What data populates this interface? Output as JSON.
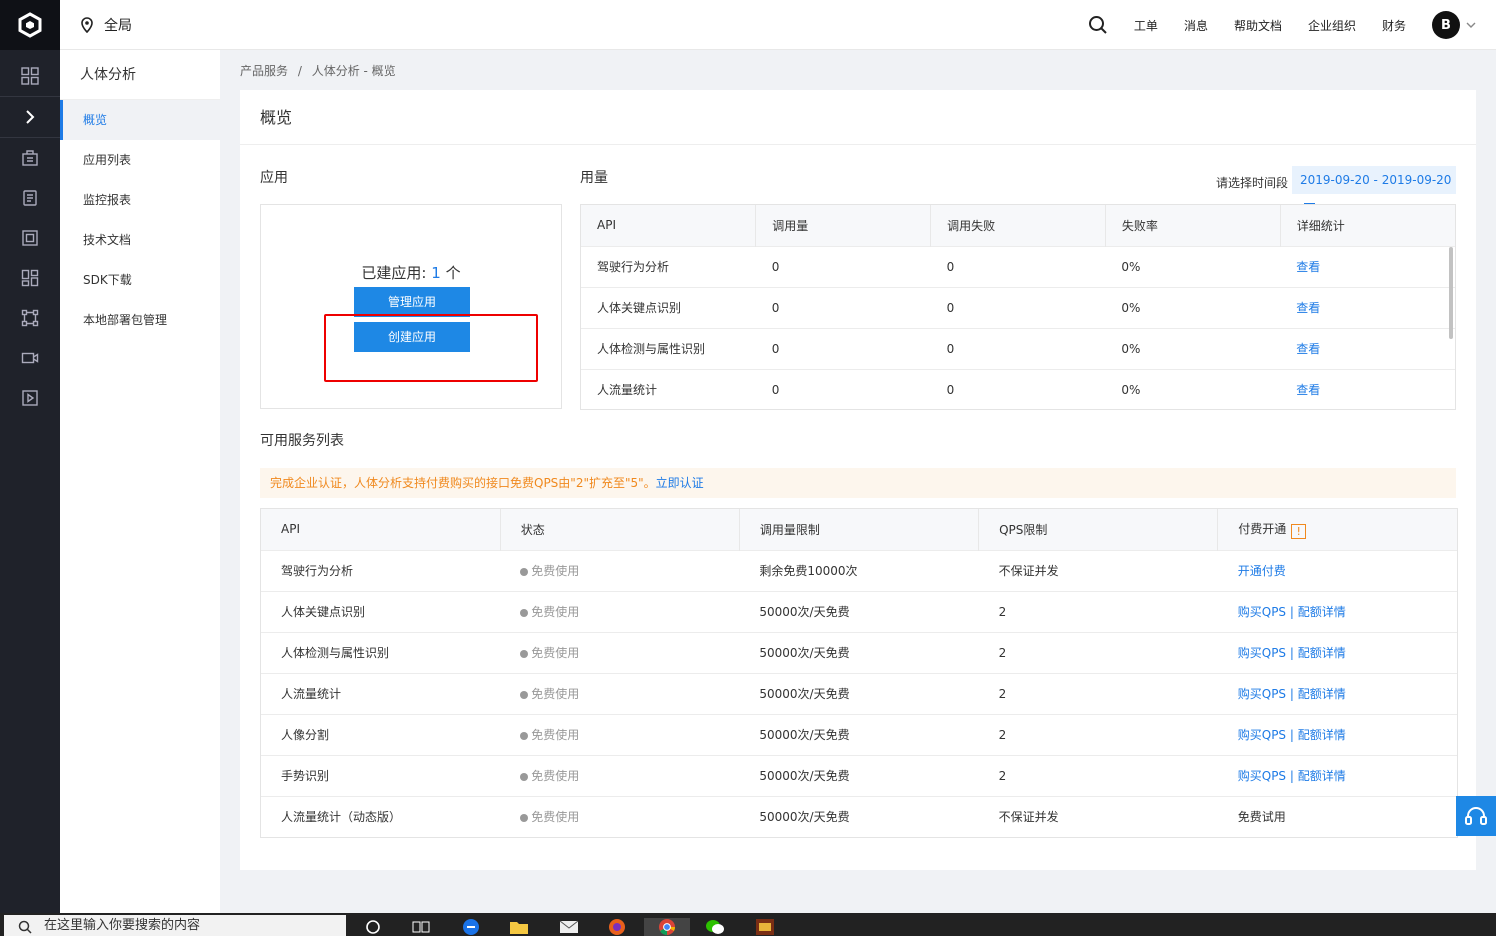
{
  "rail": {
    "icons": [
      "logo-icon",
      "grid-icon",
      "expand-chevron-icon",
      "building-icon",
      "book-icon",
      "frame-icon",
      "dashboard-icon",
      "network-icon",
      "camera-icon",
      "play-icon"
    ]
  },
  "topbar": {
    "region": "全局",
    "nav": [
      "工单",
      "消息",
      "帮助文档",
      "企业组织",
      "财务"
    ],
    "avatar": "B"
  },
  "sidenav": {
    "title": "人体分析",
    "items": [
      "概览",
      "应用列表",
      "监控报表",
      "技术文档",
      "SDK下载",
      "本地部署包管理"
    ],
    "active": "概览"
  },
  "breadcrumb": {
    "parent": "产品服务",
    "sep": "/",
    "current": "人体分析 - 概览"
  },
  "panel": {
    "title": "概览"
  },
  "apps": {
    "label": "应用",
    "count_prefix": "已建应用: ",
    "count": "1",
    "count_suffix": " 个",
    "manage_btn": "管理应用",
    "create_btn": "创建应用"
  },
  "usage": {
    "label": "用量",
    "date_label": "请选择时间段",
    "date_range": "2019-09-20 - 2019-09-20",
    "headers": [
      "API",
      "调用量",
      "调用失败",
      "失败率",
      "详细统计"
    ],
    "rows": [
      {
        "api": "驾驶行为分析",
        "calls": "0",
        "fails": "0",
        "rate": "0%",
        "detail": "查看"
      },
      {
        "api": "人体关键点识别",
        "calls": "0",
        "fails": "0",
        "rate": "0%",
        "detail": "查看"
      },
      {
        "api": "人体检测与属性识别",
        "calls": "0",
        "fails": "0",
        "rate": "0%",
        "detail": "查看"
      },
      {
        "api": "人流量统计",
        "calls": "0",
        "fails": "0",
        "rate": "0%",
        "detail": "查看"
      }
    ]
  },
  "services": {
    "label": "可用服务列表",
    "notice": "完成企业认证，人体分析支持付费购买的接口免费QPS由\"2\"扩充至\"5\"。",
    "notice_link": "立即认证",
    "headers": [
      "API",
      "状态",
      "调用量限制",
      "QPS限制",
      "付费开通"
    ],
    "info_badge": "!",
    "rows": [
      {
        "api": "驾驶行为分析",
        "status": "免费使用",
        "limit": "剩余免费10000次",
        "qps": "不保证并发",
        "pay": "开通付费",
        "pay2": "",
        "paytype": "link"
      },
      {
        "api": "人体关键点识别",
        "status": "免费使用",
        "limit": "50000次/天免费",
        "qps": "2",
        "pay": "购买QPS",
        "pay2": "配额详情",
        "paytype": "double"
      },
      {
        "api": "人体检测与属性识别",
        "status": "免费使用",
        "limit": "50000次/天免费",
        "qps": "2",
        "pay": "购买QPS",
        "pay2": "配额详情",
        "paytype": "double"
      },
      {
        "api": "人流量统计",
        "status": "免费使用",
        "limit": "50000次/天免费",
        "qps": "2",
        "pay": "购买QPS",
        "pay2": "配额详情",
        "paytype": "double"
      },
      {
        "api": "人像分割",
        "status": "免费使用",
        "limit": "50000次/天免费",
        "qps": "2",
        "pay": "购买QPS",
        "pay2": "配额详情",
        "paytype": "double"
      },
      {
        "api": "手势识别",
        "status": "免费使用",
        "limit": "50000次/天免费",
        "qps": "2",
        "pay": "购买QPS",
        "pay2": "配额详情",
        "paytype": "double"
      },
      {
        "api": "人流量统计（动态版）",
        "status": "免费使用",
        "limit": "50000次/天免费",
        "qps": "不保证并发",
        "pay": "免费试用",
        "pay2": "",
        "paytype": "text"
      }
    ]
  },
  "taskbar": {
    "search_placeholder": "在这里输入你要搜索的内容"
  },
  "colors": {
    "accent": "#1e88e5",
    "rail": "#1f222a",
    "notice": "#f0891e",
    "highlight": "#e00000"
  }
}
